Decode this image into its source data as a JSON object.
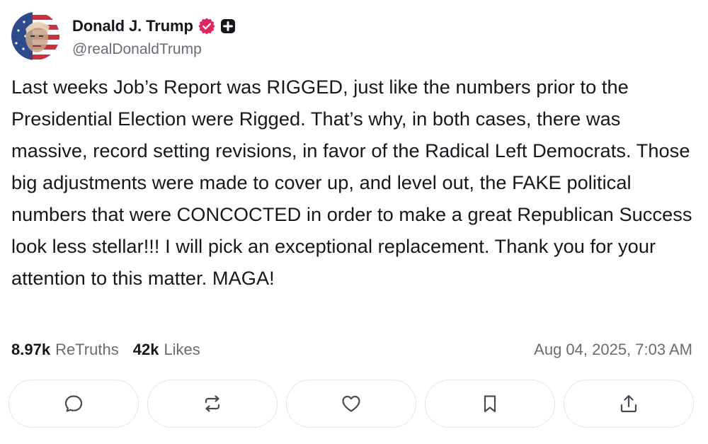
{
  "author": {
    "display_name": "Donald J. Trump",
    "handle": "@realDonaldTrump",
    "avatar": "avatar-american-flag-portrait",
    "verified_icon": "verified-badge-icon",
    "verified_color": "#e0245e",
    "plus_icon": "plus-badge-icon"
  },
  "post": {
    "text": "Last weeks Job’s Report was RIGGED, just like the numbers prior to the Presidential Election were Rigged. That’s why, in both cases, there was massive, record setting revisions, in favor of the Radical Left Democrats. Those big adjustments were made to cover up, and level out, the FAKE political numbers that were CONCOCTED in order to make a great Republican Success look less stellar!!! I will pick an exceptional replacement. Thank you for your attention to this matter. MAGA!"
  },
  "stats": {
    "retruths_count": "8.97k",
    "retruths_label": "ReTruths",
    "likes_count": "42k",
    "likes_label": "Likes",
    "timestamp": "Aug 04, 2025, 7:03 AM"
  },
  "actions": [
    {
      "name": "reply",
      "icon": "comment-icon"
    },
    {
      "name": "retruth",
      "icon": "repost-icon"
    },
    {
      "name": "like",
      "icon": "heart-icon"
    },
    {
      "name": "bookmark",
      "icon": "bookmark-icon"
    },
    {
      "name": "share",
      "icon": "share-icon"
    }
  ],
  "colors": {
    "text": "#16161d",
    "muted": "#6b6b76",
    "border": "#e6e6ea",
    "icon": "#4a4a55"
  }
}
